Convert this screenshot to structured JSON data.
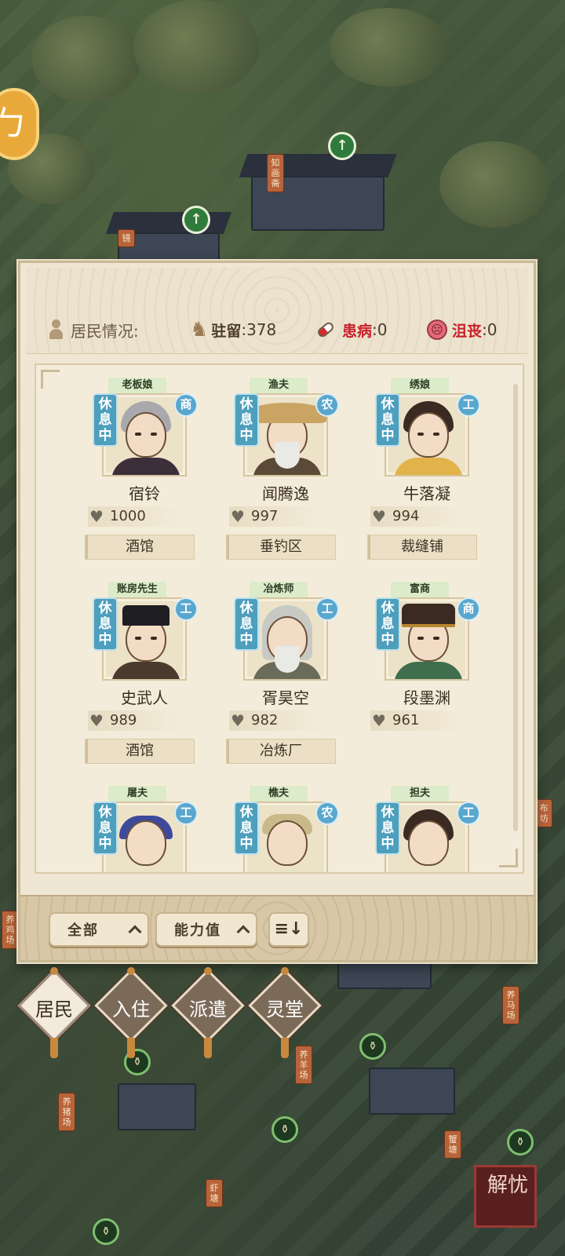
{
  "map": {
    "signs": [
      "知画斋",
      "镜",
      "布坊",
      "养鸡场",
      "养马场",
      "养羊场",
      "养猪场",
      "蟹塘",
      "虾塘"
    ],
    "seal_text": "解忧"
  },
  "header": {
    "residents_label": "居民情况:",
    "stay_label": "驻留",
    "stay_value": ":378",
    "sick_label": "患病",
    "sick_value": ":0",
    "depressed_label": "沮丧",
    "depressed_value": ":0"
  },
  "residents": [
    {
      "job": "老板娘",
      "status": "休息中",
      "type": "商",
      "name": "宿铃",
      "power": "1000",
      "workplace": "酒馆"
    },
    {
      "job": "渔夫",
      "status": "休息中",
      "type": "农",
      "name": "闻腾逸",
      "power": "997",
      "workplace": "垂钓区"
    },
    {
      "job": "绣娘",
      "status": "休息中",
      "type": "工",
      "name": "牛落凝",
      "power": "994",
      "workplace": "裁缝铺"
    },
    {
      "job": "账房先生",
      "status": "休息中",
      "type": "工",
      "name": "史武人",
      "power": "989",
      "workplace": "酒馆"
    },
    {
      "job": "冶炼师",
      "status": "休息中",
      "type": "工",
      "name": "胥昊空",
      "power": "982",
      "workplace": "冶炼厂"
    },
    {
      "job": "富商",
      "status": "休息中",
      "type": "商",
      "name": "段墨渊",
      "power": "961",
      "workplace": ""
    },
    {
      "job": "屠夫",
      "status": "休息中",
      "type": "工",
      "name": "",
      "power": "",
      "workplace": ""
    },
    {
      "job": "樵夫",
      "status": "休息中",
      "type": "农",
      "name": "",
      "power": "",
      "workplace": ""
    },
    {
      "job": "担夫",
      "status": "休息中",
      "type": "工",
      "name": "",
      "power": "",
      "workplace": ""
    }
  ],
  "footer": {
    "filter_all": "全部",
    "filter_power": "能力值",
    "sort_icon": "sort-icon"
  },
  "nav": [
    "居民",
    "入住",
    "派遣",
    "灵堂"
  ],
  "colors": {
    "rest_badge": "#4d9fbd",
    "type_badge": "#5aa7ce",
    "sick_red": "#c8202a",
    "panel_bg": "#efe6d3"
  }
}
